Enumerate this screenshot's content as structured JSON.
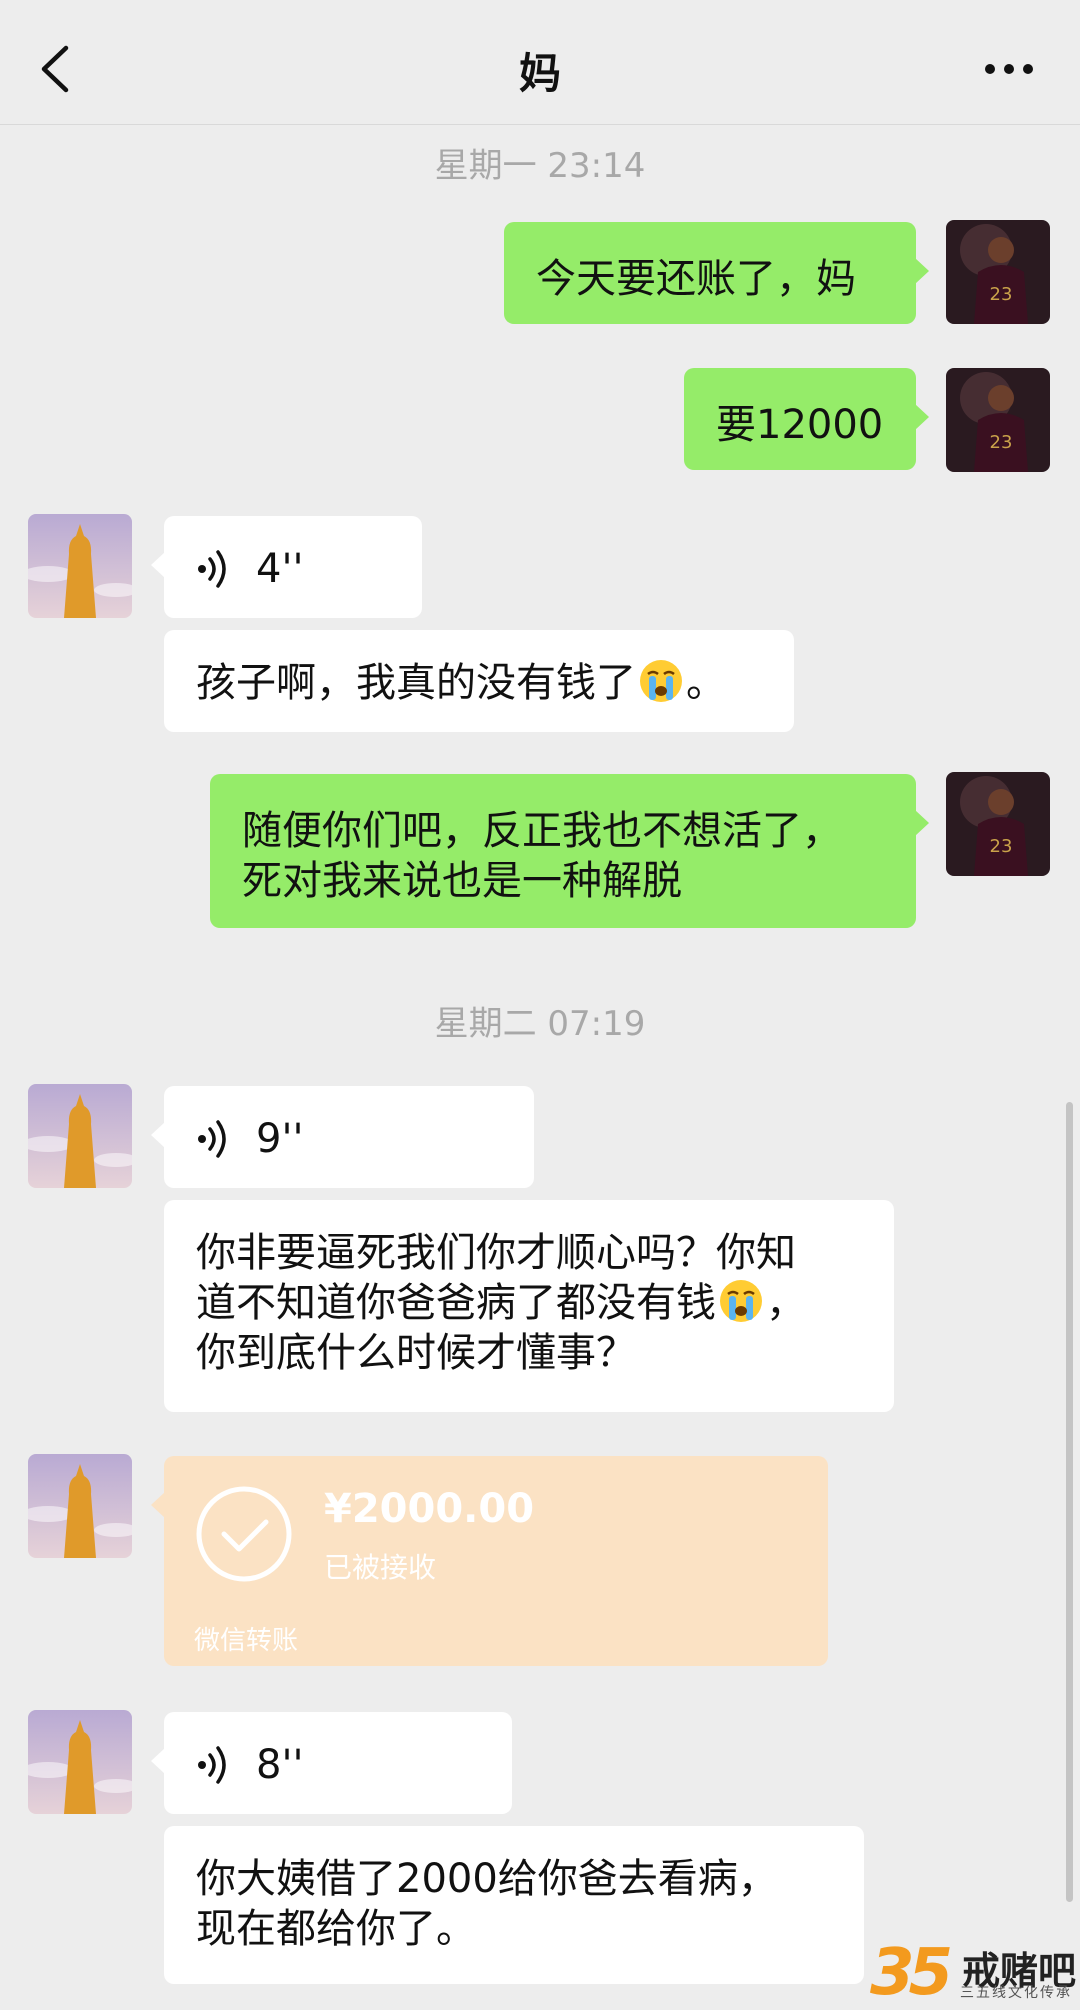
{
  "header": {
    "title": "妈"
  },
  "timestamps": [
    "星期一 23:14",
    "星期二 07:19"
  ],
  "messages": {
    "m1": "今天要还账了，妈",
    "m2": "要12000",
    "v1": "4''",
    "m3a": "孩子啊，我真的没有钱了",
    "m3b": "。",
    "m4a": "随便你们吧，反正我也不想活了，",
    "m4b": "死对我来说也是一种解脱",
    "v2": "9''",
    "m5a": "你非要逼死我们你才顺心吗？你知",
    "m5b": "道不知道你爸爸病了都没有钱",
    "m5c": "，",
    "m5d": "你到底什么时候才懂事？",
    "v3": "8''",
    "m6a": "你大姨借了2000给你爸去看病，",
    "m6b": "现在都给你了。"
  },
  "transfer": {
    "amount": "¥2000.00",
    "status": "已被接收",
    "footer": "微信转账"
  },
  "icons": {
    "back": "chevron-left-icon",
    "more": "more-dots-icon",
    "voice": "voice-wave-icon",
    "emoji": "crying-face-emoji",
    "check": "check-circle-icon"
  },
  "watermark": {
    "number": "35",
    "text": "戒赌吧",
    "sub": "三五线文化传承"
  },
  "colors": {
    "sent_bubble": "#95ec69",
    "recv_bubble": "#ffffff",
    "transfer": "#fbe2c4",
    "background": "#ededed"
  }
}
